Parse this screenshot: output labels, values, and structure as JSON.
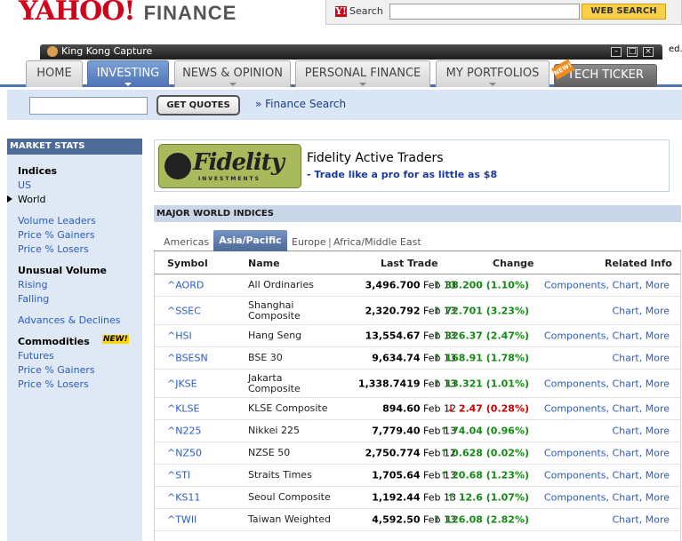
{
  "header": {
    "logo_yahoo": "YAHOO!",
    "logo_finance": "FINANCE",
    "search_label": "Search",
    "search_value": "",
    "web_search_label": "WEB SEARCH",
    "clipped_text": "ed."
  },
  "capture": {
    "title": "King Kong Capture"
  },
  "nav": {
    "tabs": [
      "HOME",
      "INVESTING",
      "NEWS & OPINION",
      "PERSONAL FINANCE",
      "MY PORTFOLIOS",
      "TECH TICKER"
    ],
    "new_badge": "NEW!"
  },
  "quote_bar": {
    "input_value": "",
    "get_quotes": "GET QUOTES",
    "finance_search": "» Finance Search"
  },
  "sidebar": {
    "title": "MARKET STATS",
    "indices": "Indices",
    "us": "US",
    "world": "World",
    "volume_leaders": "Volume Leaders",
    "price_gainers": "Price % Gainers",
    "price_losers": "Price % Losers",
    "unusual_volume": "Unusual Volume",
    "rising": "Rising",
    "falling": "Falling",
    "advances_declines": "Advances & Declines",
    "commodities": "Commodities",
    "commodities_new": "NEW!",
    "futures": "Futures",
    "c_price_gainers": "Price % Gainers",
    "c_price_losers": "Price % Losers"
  },
  "ad": {
    "logo_word": "Fidelity",
    "logo_sub": "INVESTMENTS",
    "title": "Fidelity Active Traders",
    "link": "- Trade like a pro for as little as $8"
  },
  "indices": {
    "section_title": "MAJOR WORLD INDICES",
    "region_tabs": [
      "Americas",
      "Asia/Pacific",
      "Europe",
      "Africa/Middle East"
    ],
    "columns": [
      "Symbol",
      "Name",
      "Last Trade",
      "Change",
      "Related Info"
    ],
    "rows": [
      {
        "symbol": "^AORD",
        "name": "All Ordinaries",
        "value": "3,496.700",
        "date": "Feb 13",
        "change": "38.200 (1.10%)",
        "dir": "up",
        "related": "Components, Chart, More"
      },
      {
        "symbol": "^SSEC",
        "name": "Shanghai Composite",
        "value": "2,320.792",
        "date": "Feb 13",
        "change": "72.701 (3.23%)",
        "dir": "up",
        "related": "Chart, More"
      },
      {
        "symbol": "^HSI",
        "name": "Hang Seng",
        "value": "13,554.67",
        "date": "Feb 13",
        "change": "326.37 (2.47%)",
        "dir": "up",
        "related": "Components, Chart, More"
      },
      {
        "symbol": "^BSESN",
        "name": "BSE 30",
        "value": "9,634.74",
        "date": "Feb 13",
        "change": "168.91 (1.78%)",
        "dir": "up",
        "related": "Chart, More"
      },
      {
        "symbol": "^JKSE",
        "name": "Jakarta Composite",
        "value": "1,338.7419",
        "date": "Feb 13",
        "change": "13.321 (1.01%)",
        "dir": "up",
        "related": "Components, Chart, More"
      },
      {
        "symbol": "^KLSE",
        "name": "KLSE Composite",
        "value": "894.60",
        "date": "Feb 12",
        "change": "2.47 (0.28%)",
        "dir": "down",
        "related": "Components, Chart, More"
      },
      {
        "symbol": "^N225",
        "name": "Nikkei 225",
        "value": "7,779.40",
        "date": "Feb 13",
        "change": "74.04 (0.96%)",
        "dir": "up",
        "related": "Chart, More"
      },
      {
        "symbol": "^NZ50",
        "name": "NZSE 50",
        "value": "2,750.774",
        "date": "Feb 12",
        "change": "0.628 (0.02%)",
        "dir": "up",
        "related": "Components, Chart, More"
      },
      {
        "symbol": "^STI",
        "name": "Straits Times",
        "value": "1,705.64",
        "date": "Feb 13",
        "change": "20.68 (1.23%)",
        "dir": "up",
        "related": "Components, Chart, More"
      },
      {
        "symbol": "^KS11",
        "name": "Seoul Composite",
        "value": "1,192.44",
        "date": "Feb 13",
        "change": "12.6 (1.07%)",
        "dir": "up",
        "related": "Components, Chart, More"
      },
      {
        "symbol": "^TWII",
        "name": "Taiwan Weighted",
        "value": "4,592.50",
        "date": "Feb 13",
        "change": "126.08 (2.82%)",
        "dir": "up",
        "related": "Chart, More"
      }
    ]
  },
  "colors": {
    "brand_red": "#d0031c",
    "nav_blue": "#4e73b5",
    "link_blue": "#2a5cc2",
    "up_green": "#138a13",
    "down_red": "#cc0000"
  }
}
